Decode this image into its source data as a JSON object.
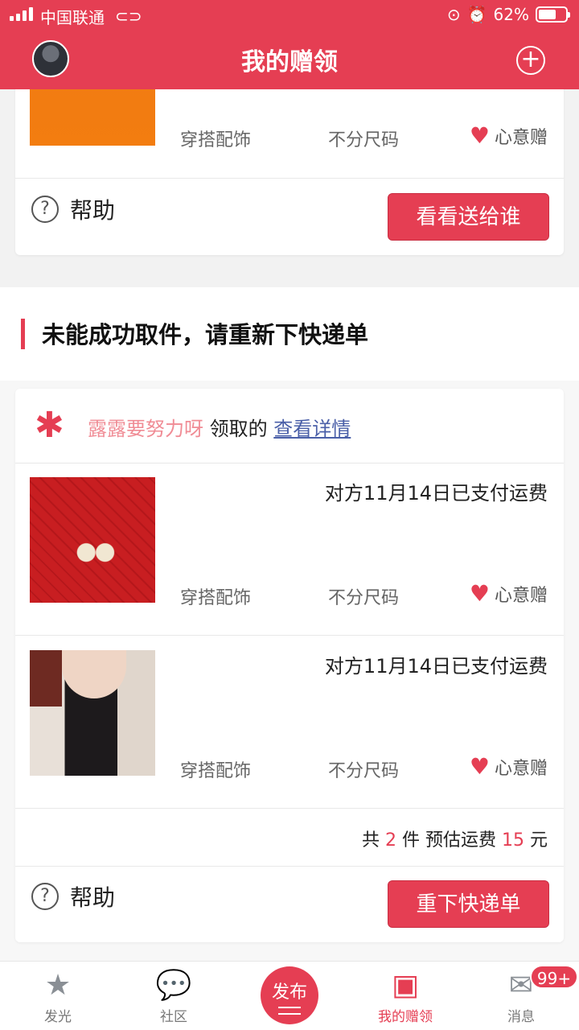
{
  "status": {
    "carrier": "中国联通",
    "battery": "62%",
    "battery_level": 0.62
  },
  "header": {
    "title": "我的赠领"
  },
  "top_card": {
    "item": {
      "category": "穿搭配饰",
      "size": "不分尺码",
      "gift_type": "心意赠"
    },
    "help": "帮助",
    "action": "看看送给谁"
  },
  "section": {
    "title": "未能成功取件，请重新下快递单"
  },
  "order": {
    "claimer": "露露要努力呀",
    "claimed_text": "领取的",
    "detail_link": "查看详情",
    "items": [
      {
        "status": "对方11月14日已支付运费",
        "category": "穿搭配饰",
        "size": "不分尺码",
        "gift_type": "心意赠"
      },
      {
        "status": "对方11月14日已支付运费",
        "category": "穿搭配饰",
        "size": "不分尺码",
        "gift_type": "心意赠"
      }
    ],
    "summary": {
      "prefix": "共",
      "count": "2",
      "unit": "件 预估运费",
      "fee": "15",
      "currency": "元"
    },
    "help": "帮助",
    "action": "重下快递单"
  },
  "tabbar": {
    "tabs": [
      {
        "label": "发光",
        "icon": "star-icon"
      },
      {
        "label": "社区",
        "icon": "chat-bubble-icon"
      },
      {
        "label": "发布",
        "icon": "publish-icon"
      },
      {
        "label": "我的赠领",
        "icon": "gift-box-icon",
        "active": true
      },
      {
        "label": "消息",
        "icon": "envelope-icon"
      }
    ],
    "message_badge": "99+"
  },
  "colors": {
    "accent": "#e53e53",
    "link": "#4a5fa8",
    "username": "#f08c95"
  }
}
